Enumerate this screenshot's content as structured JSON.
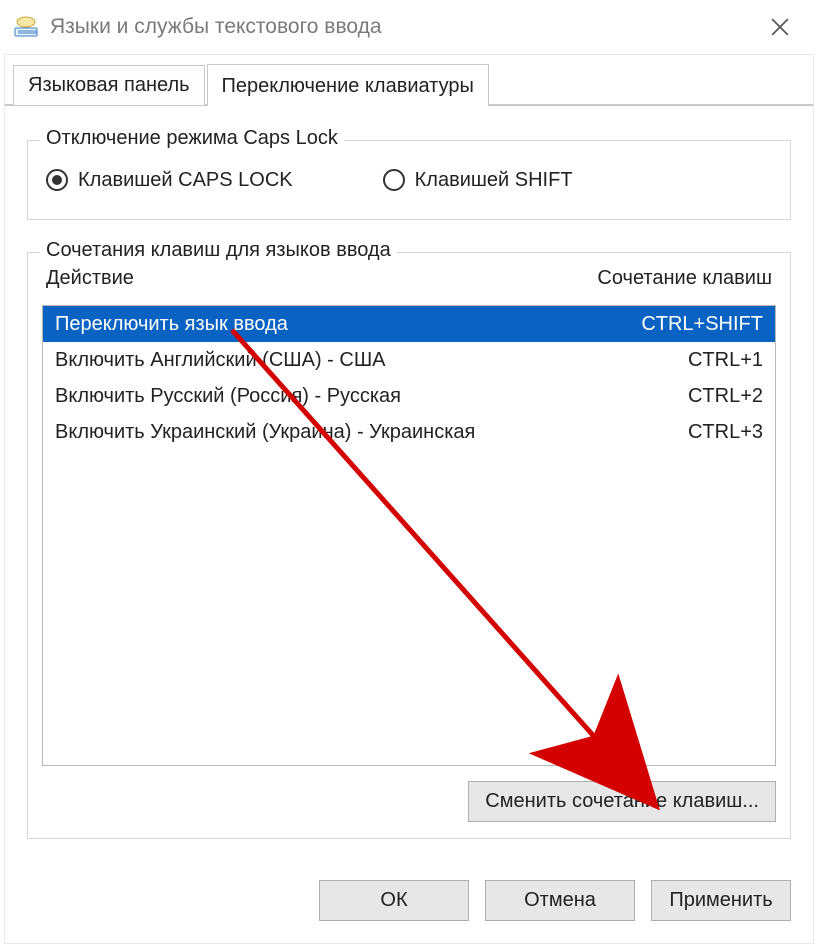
{
  "window": {
    "title": "Языки и службы текстового ввода"
  },
  "tabs": [
    {
      "label": "Языковая панель",
      "active": false
    },
    {
      "label": "Переключение клавиатуры",
      "active": true
    }
  ],
  "capslock_group": {
    "legend": "Отключение режима Caps Lock",
    "options": [
      {
        "label": "Клавишей CAPS LOCK",
        "selected": true
      },
      {
        "label": "Клавишей SHIFT",
        "selected": false
      }
    ]
  },
  "hotkeys_group": {
    "legend": "Сочетания клавиш для языков ввода",
    "columns": {
      "action": "Действие",
      "shortcut": "Сочетание клавиш"
    },
    "rows": [
      {
        "action": "Переключить язык ввода",
        "shortcut": "CTRL+SHIFT",
        "selected": true
      },
      {
        "action": "Включить Английский (США) - США",
        "shortcut": "CTRL+1",
        "selected": false
      },
      {
        "action": "Включить Русский (Россия) - Русская",
        "shortcut": "CTRL+2",
        "selected": false
      },
      {
        "action": "Включить Украинский (Украина) - Украинская",
        "shortcut": "CTRL+3",
        "selected": false
      }
    ],
    "change_button": "Сменить сочетание клавиш..."
  },
  "buttons": {
    "ok": "ОК",
    "cancel": "Отмена",
    "apply": "Применить"
  }
}
